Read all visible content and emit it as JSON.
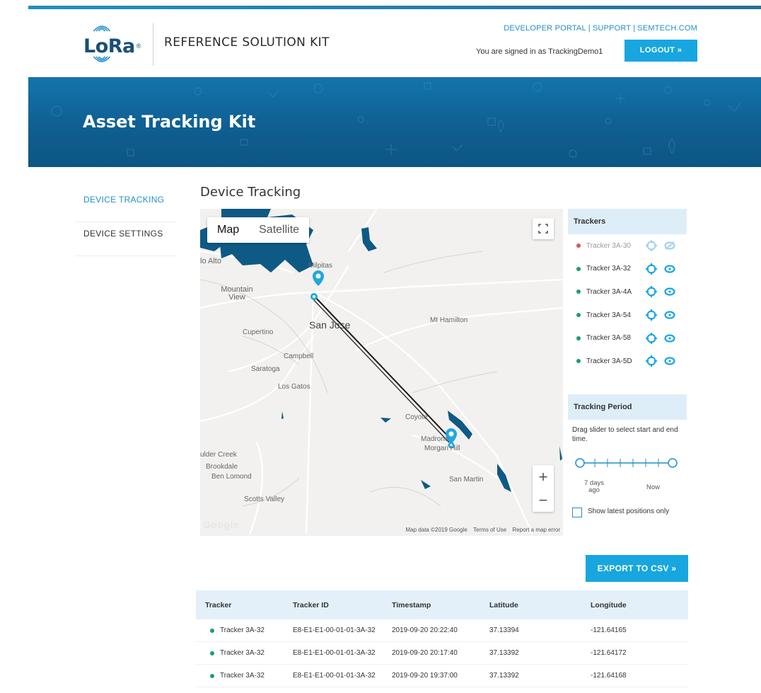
{
  "header": {
    "logo_text": "LoRa",
    "logo_mark": "®",
    "kit_name": "REFERENCE SOLUTION KIT",
    "links": [
      "DEVELOPER PORTAL",
      "SUPPORT",
      "SEMTECH.COM"
    ],
    "signed_in_text": "You are signed in as TrackingDemo1",
    "logout_label": "LOGOUT »"
  },
  "hero": {
    "title": "Asset Tracking Kit"
  },
  "sidebar": {
    "items": [
      {
        "label": "DEVICE TRACKING",
        "active": true
      },
      {
        "label": "DEVICE SETTINGS",
        "active": false
      }
    ]
  },
  "main": {
    "title": "Device Tracking"
  },
  "map": {
    "tabs": [
      "Map",
      "Satellite"
    ],
    "zoom_in": "+",
    "zoom_out": "−",
    "google_logo": "Google",
    "labels": {
      "palo_alto": "lo Alto",
      "milpitas": "Milpitas",
      "mountain_view": "Mountain View",
      "san_jose": "San Jose",
      "mt_hamilton": "Mt Hamilton",
      "cupertino": "Cupertino",
      "campbell": "Campbell",
      "saratoga": "Saratoga",
      "los_gatos": "Los Gatos",
      "coyote": "Coyote",
      "madrone": "Madrone",
      "morgan_hill": "Morgan Hill",
      "boulder_creek": "ulder Creek",
      "brookdale": "Brookdale",
      "ben_lomond": "Ben Lomond",
      "san_martin": "San Martin",
      "scotts_valley": "Scotts Valley"
    },
    "footer": [
      "Map data ©2019 Google",
      "Terms of Use",
      "Report a map error"
    ]
  },
  "trackers": {
    "heading": "Trackers",
    "items": [
      {
        "name": "Tracker 3A-30",
        "status": "inactive",
        "status_color": "#e0525d"
      },
      {
        "name": "Tracker 3A-32",
        "status": "active",
        "status_color": "#1a9a7d"
      },
      {
        "name": "Tracker 3A-4A",
        "status": "active",
        "status_color": "#1a9a7d"
      },
      {
        "name": "Tracker 3A-54",
        "status": "active",
        "status_color": "#1a9a7d"
      },
      {
        "name": "Tracker 3A-58",
        "status": "active",
        "status_color": "#1a9a7d"
      },
      {
        "name": "Tracker 3A-5D",
        "status": "active",
        "status_color": "#1a9a7d"
      }
    ]
  },
  "tracking_period": {
    "heading": "Tracking Period",
    "instructions": "Drag slider to select start and end time.",
    "start_label": "7 days ago",
    "end_label": "Now",
    "latest_only_label": "Show latest positions only",
    "latest_only_checked": false
  },
  "export_label": "EXPORT TO CSV »",
  "table": {
    "columns": [
      "Tracker",
      "Tracker ID",
      "Timestamp",
      "Latitude",
      "Longitude"
    ],
    "rows": [
      {
        "tracker": "Tracker 3A-32",
        "id": "E8-E1-E1-00-01-01-3A-32",
        "timestamp": "2019-09-20 20:22:40",
        "lat": "37.13394",
        "lon": "-121.64165"
      },
      {
        "tracker": "Tracker 3A-32",
        "id": "E8-E1-E1-00-01-01-3A-32",
        "timestamp": "2019-09-20 20:17:40",
        "lat": "37.13392",
        "lon": "-121.64172"
      },
      {
        "tracker": "Tracker 3A-32",
        "id": "E8-E1-E1-00-01-01-3A-32",
        "timestamp": "2019-09-20 19:37:00",
        "lat": "37.13392",
        "lon": "-121.64168"
      }
    ]
  },
  "colors": {
    "accent": "#17a6e0",
    "hero": "#0f5f92",
    "active_dot": "#1a9a7d",
    "inactive_dot": "#e0525d",
    "panel_header": "#deeef9",
    "water": "#0e5a84"
  }
}
